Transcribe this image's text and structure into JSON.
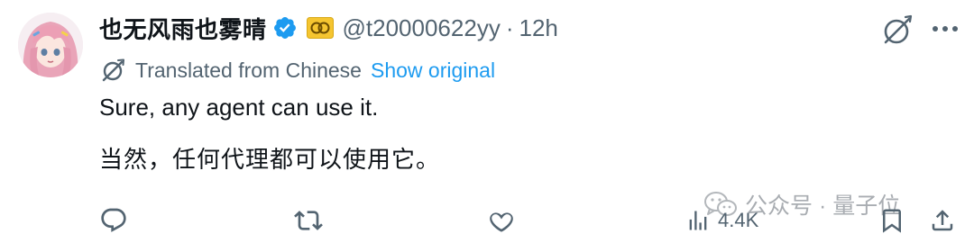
{
  "author": {
    "display_name": "也无风雨也雾晴",
    "handle": "@t20000622yy",
    "separator": "·",
    "time": "12h",
    "verified": true,
    "verified_color": "#1d9bf0",
    "affiliate_badge_color": "#f5c530"
  },
  "translation": {
    "label": "Translated from Chinese",
    "show_original": "Show original"
  },
  "tweet": {
    "text_en": "Sure, any agent can use it.",
    "text_zh": "当然，任何代理都可以使用它。"
  },
  "watermark": {
    "text": "公众号 · 量子位"
  },
  "actions": {
    "views_count": "4.4K",
    "icon_color": "#536471"
  },
  "icons": {
    "grok": "grok-icon",
    "more": "more-icon",
    "translate": "translate-icon",
    "reply": "reply-icon",
    "repost": "repost-icon",
    "like": "heart-icon",
    "views": "analytics-icon",
    "bookmark": "bookmark-icon",
    "share": "share-icon"
  }
}
